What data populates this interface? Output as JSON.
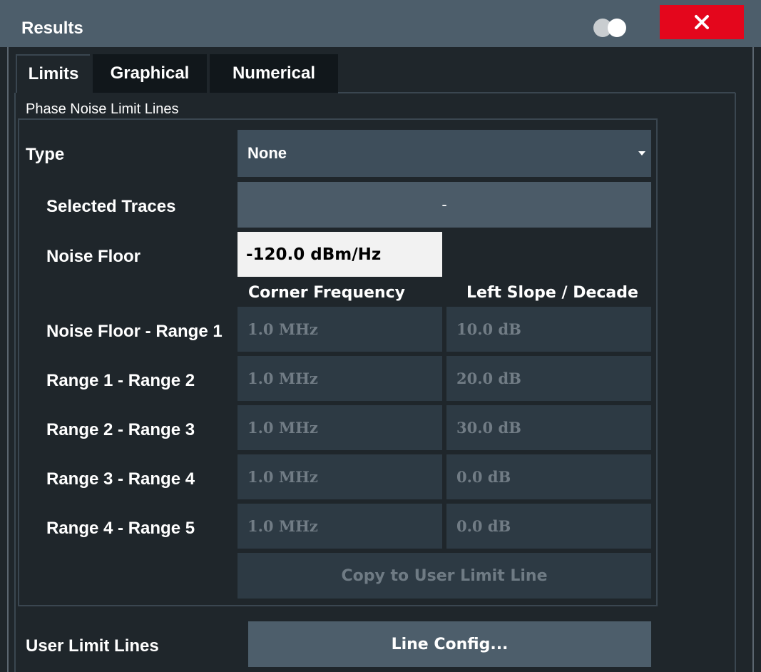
{
  "window": {
    "title": "Results",
    "close_icon": "close-icon",
    "toggle_icon": "transparency-toggle-icon",
    "accent_close": "#e4061c"
  },
  "tabs": [
    {
      "label": "Limits",
      "active": true
    },
    {
      "label": "Graphical",
      "active": false
    },
    {
      "label": "Numerical",
      "active": false
    }
  ],
  "phase_noise": {
    "group_label": "Phase Noise Limit Lines",
    "type": {
      "label": "Type",
      "value": "None"
    },
    "selected_traces": {
      "label": "Selected Traces",
      "value": "-"
    },
    "noise_floor": {
      "label": "Noise Floor",
      "value": "-120.0 dBm/Hz"
    },
    "columns": {
      "corner_frequency": "Corner Frequency",
      "left_slope": "Left Slope / Decade"
    },
    "ranges": [
      {
        "label": "Noise Floor - Range 1",
        "corner_frequency": "1.0 MHz",
        "left_slope": "10.0 dB"
      },
      {
        "label": "Range 1 - Range 2",
        "corner_frequency": "1.0 MHz",
        "left_slope": "20.0 dB"
      },
      {
        "label": "Range 2 - Range 3",
        "corner_frequency": "1.0 MHz",
        "left_slope": "30.0 dB"
      },
      {
        "label": "Range 3 - Range 4",
        "corner_frequency": "1.0 MHz",
        "left_slope": "0.0 dB"
      },
      {
        "label": "Range 4 - Range 5",
        "corner_frequency": "1.0 MHz",
        "left_slope": "0.0 dB"
      }
    ],
    "copy_button": "Copy to User Limit Line"
  },
  "user_limit_lines": {
    "label": "User Limit Lines",
    "button": "Line Config..."
  }
}
